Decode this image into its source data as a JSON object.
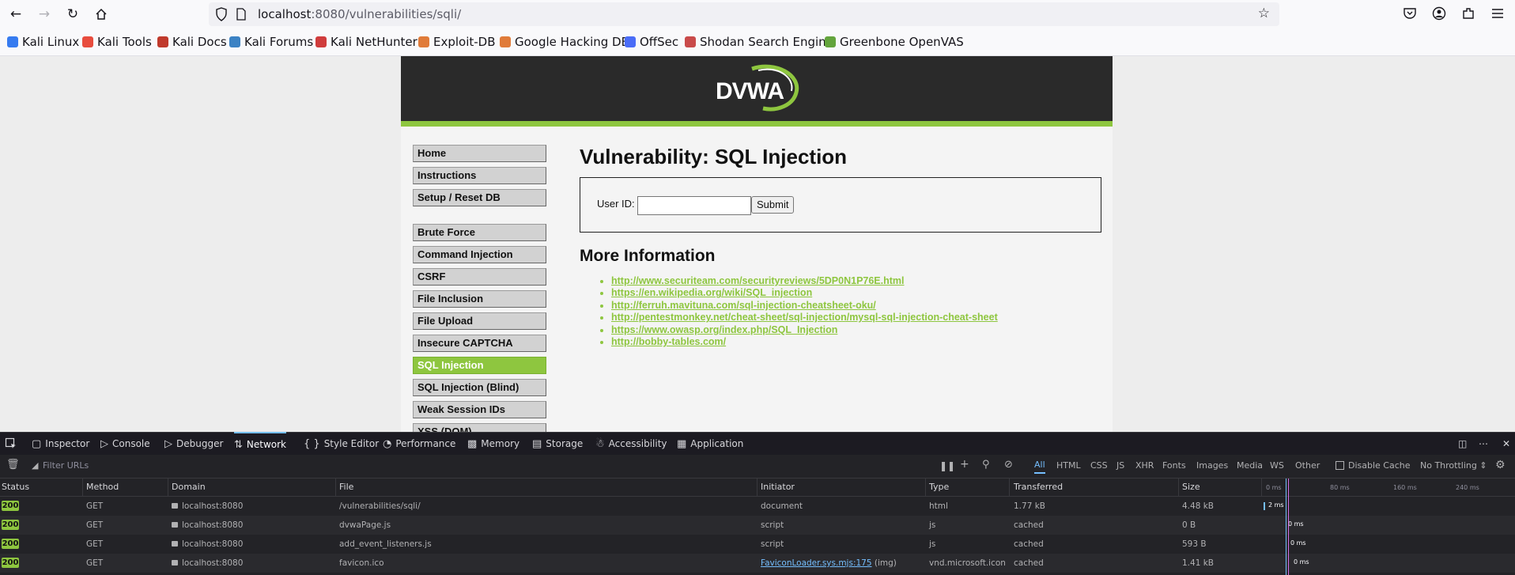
{
  "browser": {
    "url_host": "localhost",
    "url_rest": ":8080/vulnerabilities/sqli/",
    "bookmarks": [
      {
        "label": "Kali Linux",
        "color": "#367bf0"
      },
      {
        "label": "Kali Tools",
        "color": "#e84c3d"
      },
      {
        "label": "Kali Docs",
        "color": "#c0392b"
      },
      {
        "label": "Kali Forums",
        "color": "#3b82c4"
      },
      {
        "label": "Kali NetHunter",
        "color": "#d03c3c"
      },
      {
        "label": "Exploit-DB",
        "color": "#e07b39"
      },
      {
        "label": "Google Hacking DB",
        "color": "#e07b39"
      },
      {
        "label": "OffSec",
        "color": "#4a6cf7"
      },
      {
        "label": "Shodan Search Engine",
        "color": "#c94a4a"
      },
      {
        "label": "Greenbone OpenVAS",
        "color": "#63a43c"
      }
    ]
  },
  "dvwa": {
    "logo_text": "DVWA",
    "menu_group1": [
      "Home",
      "Instructions",
      "Setup / Reset DB"
    ],
    "menu_group2": [
      "Brute Force",
      "Command Injection",
      "CSRF",
      "File Inclusion",
      "File Upload",
      "Insecure CAPTCHA",
      "SQL Injection",
      "SQL Injection (Blind)",
      "Weak Session IDs",
      "XSS (DOM)"
    ],
    "selected_item": "SQL Injection",
    "title": "Vulnerability: SQL Injection",
    "user_id_label": "User ID:",
    "user_id_value": "",
    "submit_label": "Submit",
    "more_info_title": "More Information",
    "links": [
      "http://www.securiteam.com/securityreviews/5DP0N1P76E.html",
      "https://en.wikipedia.org/wiki/SQL_injection",
      "http://ferruh.mavituna.com/sql-injection-cheatsheet-oku/",
      "http://pentestmonkey.net/cheat-sheet/sql-injection/mysql-sql-injection-cheat-sheet",
      "https://www.owasp.org/index.php/SQL_Injection",
      "http://bobby-tables.com/"
    ],
    "accent": "#8ec63f"
  },
  "devtools": {
    "tabs": [
      "Inspector",
      "Console",
      "Debugger",
      "Network",
      "Style Editor",
      "Performance",
      "Memory",
      "Storage",
      "Accessibility",
      "Application"
    ],
    "active_tab": "Network",
    "filter_placeholder": "Filter URLs",
    "type_filters": [
      "All",
      "HTML",
      "CSS",
      "JS",
      "XHR",
      "Fonts",
      "Images",
      "Media",
      "WS",
      "Other"
    ],
    "disable_cache_label": "Disable Cache",
    "throttling_label": "No Throttling ⇕",
    "columns": [
      "Status",
      "Method",
      "Domain",
      "File",
      "Initiator",
      "Type",
      "Transferred",
      "Size"
    ],
    "timeline_ticks": [
      "0 ms",
      "80 ms",
      "160 ms",
      "240 ms"
    ],
    "requests": [
      {
        "status": "200",
        "method": "GET",
        "domain": "localhost:8080",
        "file": "/vulnerabilities/sqli/",
        "initiator": "document",
        "initiator_extra": "",
        "type": "html",
        "transferred": "1.77 kB",
        "size": "4.48 kB",
        "timing": "2 ms"
      },
      {
        "status": "200",
        "method": "GET",
        "domain": "localhost:8080",
        "file": "dvwaPage.js",
        "initiator": "script",
        "initiator_extra": "",
        "type": "js",
        "transferred": "cached",
        "size": "0 B",
        "timing": "0 ms"
      },
      {
        "status": "200",
        "method": "GET",
        "domain": "localhost:8080",
        "file": "add_event_listeners.js",
        "initiator": "script",
        "initiator_extra": "",
        "type": "js",
        "transferred": "cached",
        "size": "593 B",
        "timing": "0 ms"
      },
      {
        "status": "200",
        "method": "GET",
        "domain": "localhost:8080",
        "file": "favicon.ico",
        "initiator": "FaviconLoader.sys.mjs:175",
        "initiator_extra": "(img)",
        "type": "vnd.microsoft.icon",
        "transferred": "cached",
        "size": "1.41 kB",
        "timing": "0 ms"
      }
    ]
  }
}
